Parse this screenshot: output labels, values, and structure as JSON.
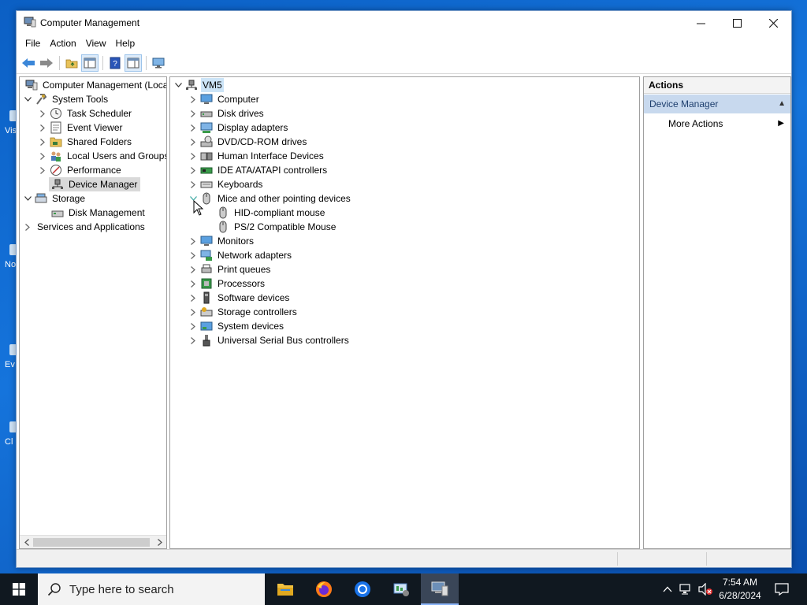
{
  "window": {
    "title": "Computer Management",
    "controls": {
      "minimize": "—",
      "maximize": "☐",
      "close": "✕"
    }
  },
  "menu": [
    "File",
    "Action",
    "View",
    "Help"
  ],
  "toolbar": [
    "back-arrow-icon",
    "forward-arrow-icon",
    "up-folder-icon",
    "show-hide-tree-icon",
    "help-icon",
    "properties-icon",
    "monitor-icon"
  ],
  "left_tree": [
    {
      "label": "Computer Management (Local",
      "chevron": "",
      "icon": "computer-management-icon"
    },
    {
      "label": "System Tools",
      "chevron": "v",
      "icon": "tools-icon"
    },
    {
      "label": "Task Scheduler",
      "chevron": ">",
      "icon": "clock-icon"
    },
    {
      "label": "Event Viewer",
      "chevron": ">",
      "icon": "event-viewer-icon"
    },
    {
      "label": "Shared Folders",
      "chevron": ">",
      "icon": "shared-folder-icon"
    },
    {
      "label": "Local Users and Groups",
      "chevron": ">",
      "icon": "users-icon"
    },
    {
      "label": "Performance",
      "chevron": ">",
      "icon": "performance-icon"
    },
    {
      "label": "Device Manager",
      "chevron": "",
      "icon": "device-manager-icon"
    },
    {
      "label": "Storage",
      "chevron": "v",
      "icon": "storage-icon"
    },
    {
      "label": "Disk Management",
      "chevron": "",
      "icon": "disk-management-icon"
    },
    {
      "label": "Services and Applications",
      "chevron": ">",
      "icon": "services-icon"
    }
  ],
  "device_tree": {
    "root": "VM5",
    "categories": [
      {
        "label": "Computer",
        "icon": "computer-icon"
      },
      {
        "label": "Disk drives",
        "icon": "disk-drive-icon"
      },
      {
        "label": "Display adapters",
        "icon": "display-adapter-icon"
      },
      {
        "label": "DVD/CD-ROM drives",
        "icon": "dvd-icon"
      },
      {
        "label": "Human Interface Devices",
        "icon": "hid-icon"
      },
      {
        "label": "IDE ATA/ATAPI controllers",
        "icon": "ide-controller-icon"
      },
      {
        "label": "Keyboards",
        "icon": "keyboard-icon"
      },
      {
        "label": "Mice and other pointing devices",
        "icon": "mouse-icon",
        "expanded": true,
        "children": [
          "HID-compliant mouse",
          "PS/2 Compatible Mouse"
        ]
      },
      {
        "label": "Monitors",
        "icon": "monitor-icon"
      },
      {
        "label": "Network adapters",
        "icon": "network-adapter-icon"
      },
      {
        "label": "Print queues",
        "icon": "printer-icon"
      },
      {
        "label": "Processors",
        "icon": "processor-icon"
      },
      {
        "label": "Software devices",
        "icon": "software-device-icon"
      },
      {
        "label": "Storage controllers",
        "icon": "storage-controller-icon"
      },
      {
        "label": "System devices",
        "icon": "system-devices-icon"
      },
      {
        "label": "Universal Serial Bus controllers",
        "icon": "usb-icon"
      }
    ]
  },
  "actions_pane": {
    "header": "Actions",
    "section": "Device Manager",
    "item": "More Actions"
  },
  "desktop_icons": [
    "Vis",
    "No",
    "Ev",
    "Cl"
  ],
  "taskbar": {
    "search_placeholder": "Type here to search",
    "apps": [
      "file-explorer-icon",
      "firefox-icon",
      "chrome-icon",
      "task-manager-icon",
      "computer-management-icon"
    ],
    "time": "7:54 AM",
    "date": "6/28/2024"
  },
  "colors": {
    "desktop": "#0b5fc4",
    "taskbar": "#101820",
    "selection": "#d9d9d9",
    "actions_section": "#c8d9ee"
  }
}
